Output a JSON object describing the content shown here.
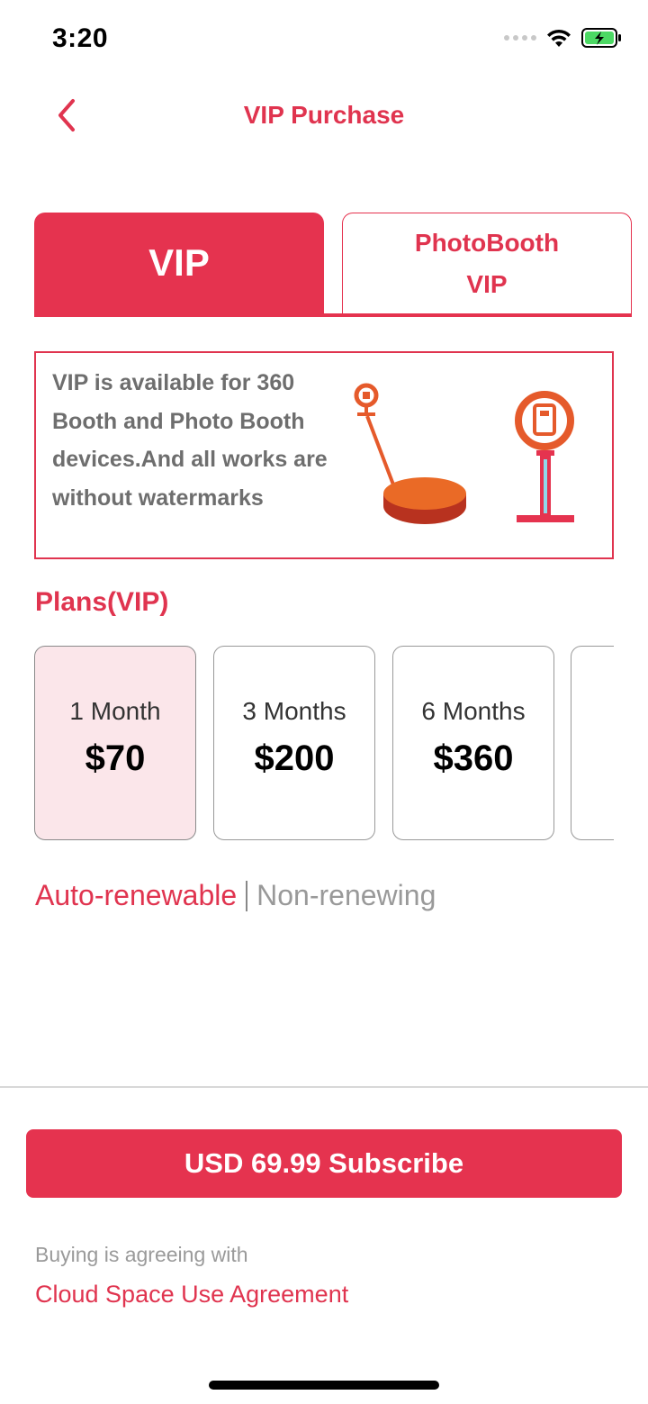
{
  "status_bar": {
    "time": "3:20",
    "icons": [
      "signal-icon",
      "wifi-icon",
      "battery-charging-icon"
    ],
    "battery_color": "#4cd964"
  },
  "nav": {
    "back_icon": "chevron-left-icon",
    "title": "VIP Purchase"
  },
  "tabs": [
    {
      "label": "VIP",
      "active": true
    },
    {
      "label": "PhotoBooth\nVIP",
      "active": false
    }
  ],
  "info": {
    "text": "VIP is available for 360 Booth and Photo Booth devices.And all works are without watermarks",
    "illustration": [
      "360-booth-icon",
      "photo-booth-icon"
    ]
  },
  "plans": {
    "title": "Plans(VIP)",
    "items": [
      {
        "name": "1 Month",
        "price": "$70",
        "selected": true
      },
      {
        "name": "3 Months",
        "price": "$200",
        "selected": false
      },
      {
        "name": "6 Months",
        "price": "$360",
        "selected": false
      }
    ]
  },
  "renew": {
    "auto_label": "Auto-renewable",
    "non_label": "Non-renewing",
    "selected": "auto"
  },
  "subscribe": {
    "label": "USD 69.99 Subscribe"
  },
  "agreement": {
    "prefix": "Buying is agreeing with",
    "link_label": "Cloud Space Use Agreement"
  },
  "colors": {
    "accent": "#e5334f",
    "selected_plan_bg": "#fbe6ea",
    "muted_text": "#9a9a9a"
  }
}
